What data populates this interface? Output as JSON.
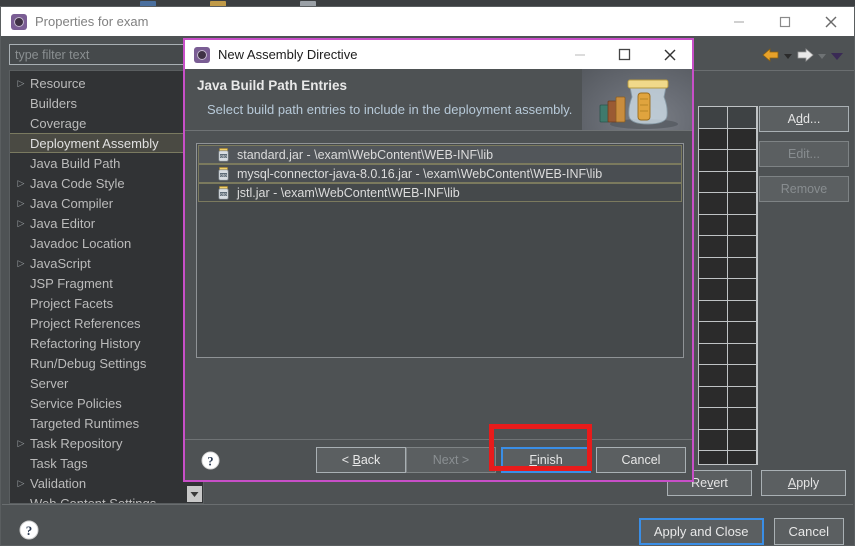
{
  "parent_window": {
    "title": "Properties for exam",
    "title_icon": "eclipse-gear-icon",
    "window_controls": {
      "minimize": "–",
      "maximize": "□",
      "close": "✕"
    },
    "filter": {
      "placeholder": "type filter text",
      "value": ""
    },
    "tree_items": [
      {
        "label": "Resource",
        "expandable": true,
        "selected": false
      },
      {
        "label": "Builders",
        "expandable": false,
        "selected": false
      },
      {
        "label": "Coverage",
        "expandable": false,
        "selected": false
      },
      {
        "label": "Deployment Assembly",
        "expandable": false,
        "selected": true
      },
      {
        "label": "Java Build Path",
        "expandable": false,
        "selected": false
      },
      {
        "label": "Java Code Style",
        "expandable": true,
        "selected": false
      },
      {
        "label": "Java Compiler",
        "expandable": true,
        "selected": false
      },
      {
        "label": "Java Editor",
        "expandable": true,
        "selected": false
      },
      {
        "label": "Javadoc Location",
        "expandable": false,
        "selected": false
      },
      {
        "label": "JavaScript",
        "expandable": true,
        "selected": false
      },
      {
        "label": "JSP Fragment",
        "expandable": false,
        "selected": false
      },
      {
        "label": "Project Facets",
        "expandable": false,
        "selected": false
      },
      {
        "label": "Project References",
        "expandable": false,
        "selected": false
      },
      {
        "label": "Refactoring History",
        "expandable": false,
        "selected": false
      },
      {
        "label": "Run/Debug Settings",
        "expandable": false,
        "selected": false
      },
      {
        "label": "Server",
        "expandable": false,
        "selected": false
      },
      {
        "label": "Service Policies",
        "expandable": false,
        "selected": false
      },
      {
        "label": "Targeted Runtimes",
        "expandable": false,
        "selected": false
      },
      {
        "label": "Task Repository",
        "expandable": true,
        "selected": false
      },
      {
        "label": "Task Tags",
        "expandable": false,
        "selected": false
      },
      {
        "label": "Validation",
        "expandable": true,
        "selected": false
      },
      {
        "label": "Web Content Settings",
        "expandable": false,
        "selected": false
      }
    ],
    "nav": {
      "back_icon": "back-arrow-icon",
      "back_menu_icon": "chevron-down-icon",
      "forward_icon": "forward-arrow-icon",
      "forward_menu_icon": "chevron-down-icon",
      "view_menu_icon": "view-menu-chevron-icon"
    },
    "side_buttons": [
      {
        "label": "Add...",
        "mnemonic": "d",
        "enabled": true
      },
      {
        "label": "Edit...",
        "mnemonic": "",
        "enabled": false
      },
      {
        "label": "Remove",
        "mnemonic": "",
        "enabled": false
      }
    ],
    "table": {
      "columns": 2,
      "rows": 17,
      "header_row": true
    },
    "page_buttons": [
      {
        "label": "Revert",
        "mnemonic": "v",
        "enabled": true
      },
      {
        "label": "Apply",
        "mnemonic": "A",
        "enabled": true
      }
    ],
    "footer_buttons": [
      {
        "label": "Apply and Close",
        "focused": true
      },
      {
        "label": "Cancel",
        "focused": false
      }
    ],
    "help_icon": "help-question-icon"
  },
  "dialog": {
    "title": "New Assembly Directive",
    "title_icon": "eclipse-gear-icon",
    "window_controls": {
      "minimize": "–",
      "maximize": "□",
      "close": "✕"
    },
    "banner": {
      "title": "Java Build Path Entries",
      "subtitle": "Select build path entries to include in the deployment assembly.",
      "image": "jar-with-books-icon"
    },
    "entries": [
      {
        "icon": "jar-file-icon",
        "label": "standard.jar - \\exam\\WebContent\\WEB-INF\\lib"
      },
      {
        "icon": "jar-file-icon",
        "label": "mysql-connector-java-8.0.16.jar - \\exam\\WebContent\\WEB-INF\\lib"
      },
      {
        "icon": "jar-file-icon",
        "label": "jstl.jar - \\exam\\WebContent\\WEB-INF\\lib"
      }
    ],
    "help_icon": "help-question-icon",
    "wizard_buttons": [
      {
        "label": "< Back",
        "enabled": true,
        "focused": false
      },
      {
        "label": "Next >",
        "enabled": false,
        "focused": false
      },
      {
        "label": "Finish",
        "enabled": true,
        "focused": true
      },
      {
        "label": "Cancel",
        "enabled": true,
        "focused": false
      }
    ]
  },
  "annotation": {
    "highlight_target": "Finish",
    "color": "#e81b1b"
  },
  "colors": {
    "dialog_border": "#c84fc8",
    "focus_blue": "#3a8ee6",
    "panel_bg": "#4e5254",
    "tree_bg": "#313335",
    "annotation_red": "#e81b1b"
  }
}
